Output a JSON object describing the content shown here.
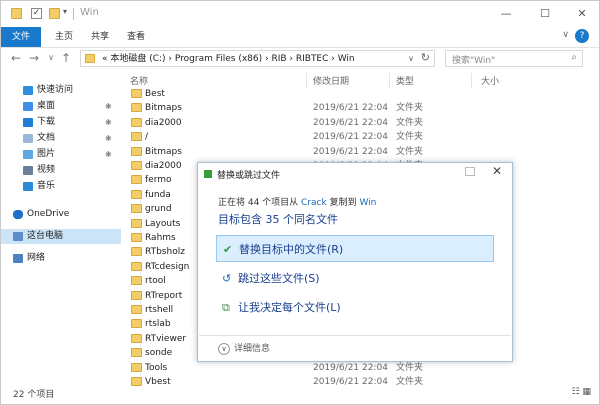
{
  "window": {
    "title": "Win",
    "quick_access": [
      "folder-icon",
      "properties-check-icon",
      "new-folder-icon",
      "customize-dropdown"
    ],
    "controls": {
      "minimize": "—",
      "maximize": "☐",
      "close": "✕"
    }
  },
  "ribbon": {
    "tabs": [
      "文件",
      "主页",
      "共享",
      "查看"
    ],
    "help": "?",
    "expand": "∨",
    "accent": "#1979ca"
  },
  "nav": {
    "back": "←",
    "forward": "→",
    "recent": "∨",
    "up": "↑",
    "address": "« 本地磁盘 (C:)  ›  Program Files (x86)  ›  RIB  ›  RIBTEC  ›  Win",
    "address_dropdown": "∨",
    "refresh": "↻",
    "search_placeholder": "搜索\"Win\"",
    "search_icon": "⌕"
  },
  "sidebar": {
    "items": [
      {
        "label": "快速访问",
        "icon": "star-icon",
        "pinned": false
      },
      {
        "label": "桌面",
        "icon": "desktop-icon",
        "pinned": true
      },
      {
        "label": "下载",
        "icon": "download-icon",
        "pinned": true
      },
      {
        "label": "文档",
        "icon": "documents-icon",
        "pinned": true
      },
      {
        "label": "图片",
        "icon": "pictures-icon",
        "pinned": true
      },
      {
        "label": "视频",
        "icon": "video-icon",
        "pinned": false
      },
      {
        "label": "音乐",
        "icon": "music-icon",
        "pinned": false
      },
      {
        "label": "OneDrive",
        "icon": "cloud-icon",
        "pinned": false
      },
      {
        "label": "这台电脑",
        "icon": "computer-icon",
        "pinned": false
      },
      {
        "label": "网络",
        "icon": "network-icon",
        "pinned": false
      }
    ],
    "pin_glyph": "✱"
  },
  "list": {
    "headers": {
      "name": "名称",
      "date": "修改日期",
      "type": "类型",
      "size": "大小"
    },
    "rows": [
      {
        "name": "Best",
        "date": "",
        "type": ""
      },
      {
        "name": "Bitmaps",
        "date": "2019/6/21 22:04",
        "type": "文件夹"
      },
      {
        "name": "dia2000",
        "date": "2019/6/21 22:04",
        "type": "文件夹"
      },
      {
        "name": "/",
        "date": "2019/6/21 22:04",
        "type": "文件夹"
      },
      {
        "name": "Bitmaps",
        "date": "2019/6/21 22:04",
        "type": "文件夹"
      },
      {
        "name": "dia2000",
        "date": "2019/6/21 22:04",
        "type": "文件夹"
      },
      {
        "name": "fermo",
        "date": "",
        "type": ""
      },
      {
        "name": "funda",
        "date": "",
        "type": ""
      },
      {
        "name": "grund",
        "date": "",
        "type": ""
      },
      {
        "name": "Layouts",
        "date": "",
        "type": ""
      },
      {
        "name": "Rahms",
        "date": "",
        "type": ""
      },
      {
        "name": "RTbsholz",
        "date": "",
        "type": ""
      },
      {
        "name": "RTcdesign",
        "date": "",
        "type": ""
      },
      {
        "name": "rtool",
        "date": "",
        "type": ""
      },
      {
        "name": "RTreport",
        "date": "",
        "type": ""
      },
      {
        "name": "rtshell",
        "date": "",
        "type": ""
      },
      {
        "name": "rtslab",
        "date": "",
        "type": ""
      },
      {
        "name": "RTviewer",
        "date": "",
        "type": ""
      },
      {
        "name": "sonde",
        "date": "",
        "type": ""
      },
      {
        "name": "Tools",
        "date": "2019/6/21 22:04",
        "type": "文件夹"
      },
      {
        "name": "Vbest",
        "date": "2019/6/21 22:04",
        "type": "文件夹"
      }
    ]
  },
  "status": {
    "count": "22 个项目",
    "view_icons": "☷ ▦"
  },
  "dialog": {
    "title": "替换或跳过文件",
    "controls": {
      "close": "✕"
    },
    "progress_prefix": "正在将 44 个项目从 ",
    "source": "Crack",
    "progress_mid": " 复制到 ",
    "dest": "Win",
    "summary": "目标包含 35 个同名文件",
    "options": [
      {
        "label": "替换目标中的文件(R)",
        "icon": "✔",
        "selected": true
      },
      {
        "label": "跳过这些文件(S)",
        "icon": "↺",
        "selected": false
      },
      {
        "label": "让我决定每个文件(L)",
        "icon": "⧉",
        "selected": false
      }
    ],
    "more_icon": "∨",
    "more_label": "详细信息"
  }
}
